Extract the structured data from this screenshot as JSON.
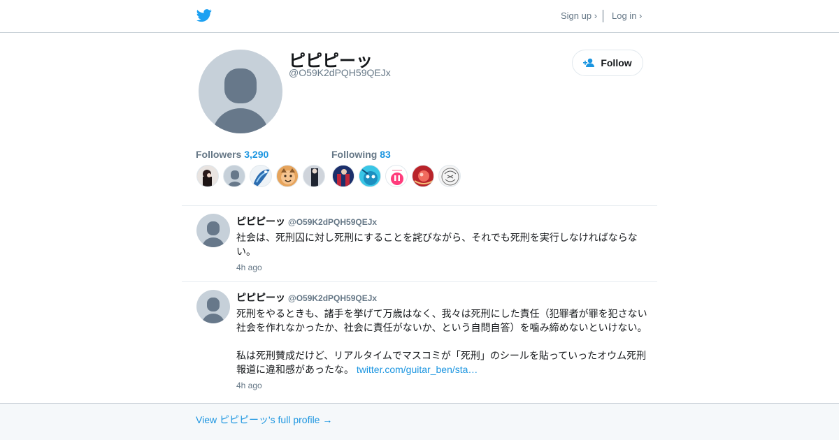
{
  "header": {
    "logo_icon": "twitter-bird-icon",
    "signup_label": "Sign up ›",
    "login_label": "Log in ›",
    "brand_color": "#1da1f2"
  },
  "profile": {
    "name": "ピピピーッ",
    "handle": "@O59K2dPQH59QEJx",
    "follow_label": "Follow",
    "follow_icon": "add-user-icon",
    "followers_label": "Followers",
    "followers_count": "3,290",
    "following_label": "Following",
    "following_count": "83"
  },
  "tweets": [
    {
      "name": "ピピピーッ",
      "handle": "@O59K2dPQH59QEJx",
      "text": "社会は、死刑囚に対し死刑にすることを詫びながら、それでも死刑を実行しなければならない。",
      "time": "4h ago"
    },
    {
      "name": "ピピピーッ",
      "handle": "@O59K2dPQH59QEJx",
      "text": "死刑をやるときも、諸手を挙げて万歳はなく、我々は死刑にした責任（犯罪者が罪を犯さない社会を作れなかったか、社会に責任がないか、という自問自答）を噛み締めないといけない。\n\n私は死刑賛成だけど、リアルタイムでマスコミが「死刑」のシールを貼っていったオウム死刑報道に違和感があったな。",
      "link": "twitter.com/guitar_ben/sta…",
      "time": "4h ago"
    }
  ],
  "footer": {
    "full_profile_label": "View ピピピーッ's full profile →"
  }
}
